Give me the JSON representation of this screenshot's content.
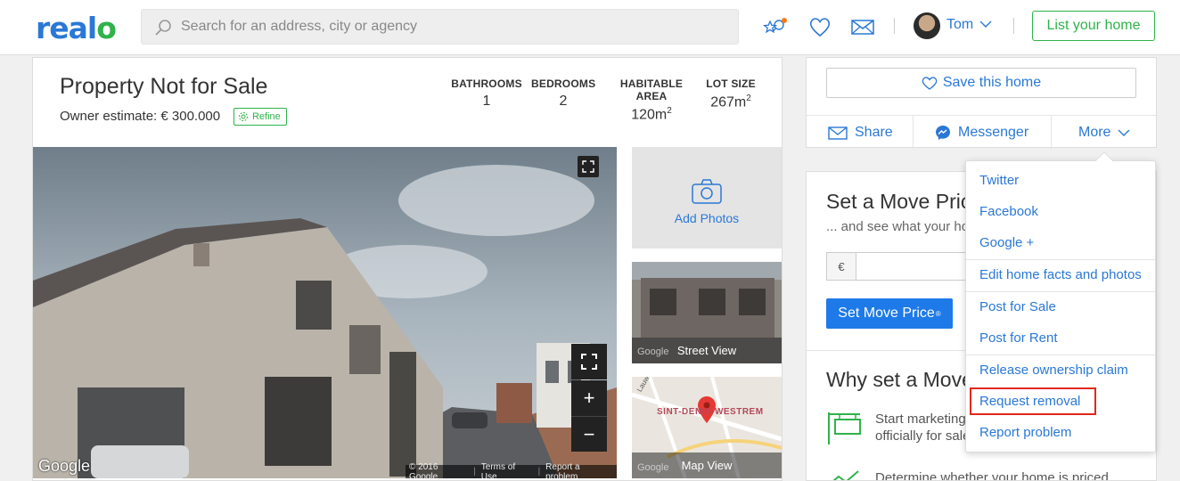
{
  "header": {
    "logo_text": "real",
    "logo_o": "o",
    "search_placeholder": "Search for an address, city or agency",
    "user_name": "Tom",
    "list_home_label": "List your home"
  },
  "property": {
    "title": "Property Not for Sale",
    "owner_estimate": "Owner estimate: € 300.000",
    "refine_label": "Refine",
    "stats": [
      {
        "label": "BATHROOMS",
        "value": "1"
      },
      {
        "label": "BEDROOMS",
        "value": "2"
      },
      {
        "label": "HABITABLE AREA",
        "value": "120m",
        "sup": "2"
      },
      {
        "label": "LOT SIZE",
        "value": "267m",
        "sup": "2"
      }
    ]
  },
  "photo": {
    "google_logo": "Google",
    "attribution": "© 2016 Google",
    "terms": "Terms of Use",
    "report": "Report a problem",
    "zoom_in": "+",
    "zoom_out": "−"
  },
  "tiles": {
    "add_photos": "Add Photos",
    "street_view": "Street View",
    "map_view": "Map View",
    "map_street": "Lauwstraat",
    "map_area": "SINT-DENIS-WESTREM",
    "google_small": "Google"
  },
  "actions": {
    "save_label": "Save this home",
    "share_label": "Share",
    "messenger_label": "Messenger",
    "more_label": "More"
  },
  "move_price": {
    "title": "Set a Move Price",
    "subtitle": "... and see what your home",
    "currency": "€",
    "button_label": "Set Move Price",
    "button_sup": "®",
    "why_title": "Why set a Move Price?",
    "reason1_line1": "Start marketing your home",
    "reason1_line2": "officially for sale",
    "reason2_line1": "Determine whether your home is priced"
  },
  "dropdown": {
    "items": [
      "Twitter",
      "Facebook",
      "Google +",
      "Edit home facts and photos",
      "Post for Sale",
      "Post for Rent",
      "Release ownership claim",
      "Request removal",
      "Report problem"
    ]
  },
  "colors": {
    "brand_blue": "#2a78d6",
    "brand_green": "#2fb34a",
    "highlight_red": "#e0281c"
  }
}
